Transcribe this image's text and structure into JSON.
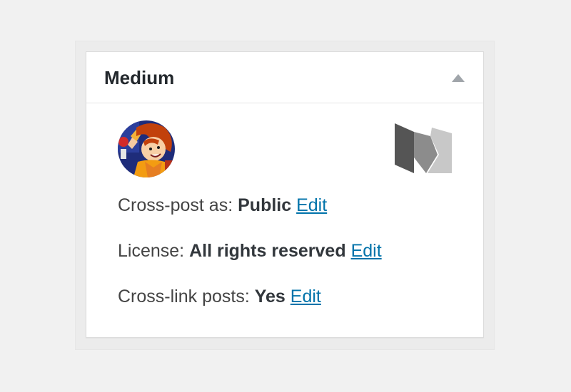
{
  "metabox": {
    "title": "Medium",
    "toggle_icon": "triangle-up-icon"
  },
  "profile": {
    "avatar_icon": "user-avatar",
    "logo_icon": "medium-logo-icon"
  },
  "settings": [
    {
      "label": "Cross-post as:",
      "value": "Public",
      "edit_label": "Edit"
    },
    {
      "label": "License:",
      "value": "All rights reserved",
      "edit_label": "Edit"
    },
    {
      "label": "Cross-link posts:",
      "value": "Yes",
      "edit_label": "Edit"
    }
  ],
  "colors": {
    "link": "#0073aa",
    "text": "#444444",
    "title": "#23282d",
    "logo_dark": "#555555",
    "logo_mid": "#8c8c8c",
    "logo_light": "#c8c8c8"
  }
}
